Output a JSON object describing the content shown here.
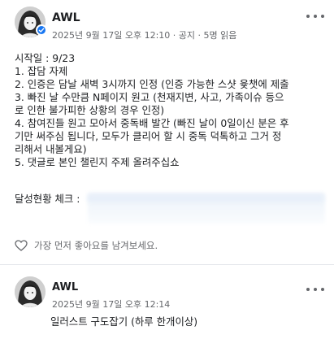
{
  "post": {
    "author": "AWL",
    "meta": "2025년 9월 17일 오후 12:10 · 공지 · 5명 읽음",
    "lines": [
      "시작일 : 9/23",
      "1. 잡담 자제",
      "2. 인증은 담날 새벽 3시까지 인정 (인증 가능한 스샷 윷챗에 제출",
      "3. 빠진 날 수만큼 N페이지 원고 (천재지변, 사고, 가족이슈 등으",
      "로 인한 불가피한 상황의 경우 인정)",
      "4. 참여진들 원고 모아서 중독배 발간 (빠진 날이 0일이신 분은 후",
      "기만 써주심 됩니다, 모두가 클리어 할 시 중독 덕톡하고 그거 정",
      "리해서 내볼게요)",
      "5. 댓글로 본인 챌린지 주제 올려주십쇼"
    ],
    "progress_label": "달성현황 체크 :",
    "like_prompt": "가장 먼저 좋아요를 남겨보세요."
  },
  "comment": {
    "author": "AWL",
    "meta": "2025년 9월 17일 오후 12:14",
    "text": "일러스트 구도잡기 (하루 한개이상)"
  },
  "colors": {
    "text": "#1c1e21",
    "muted": "#65676b",
    "verified": "#1877f2"
  },
  "icons": [
    "verified-badge-icon",
    "more-options-icon",
    "like-icon"
  ]
}
